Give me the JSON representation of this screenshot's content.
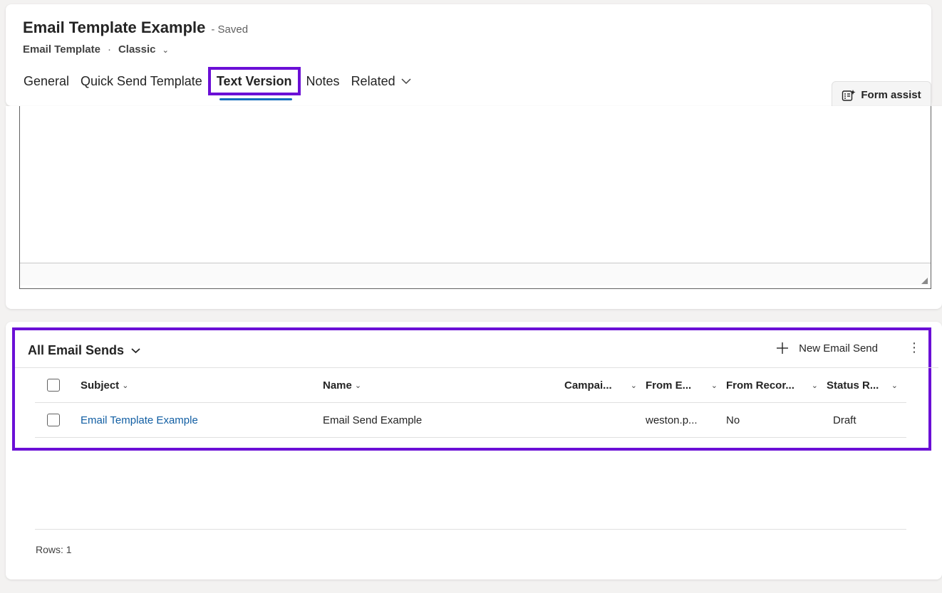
{
  "header": {
    "title": "Email Template Example",
    "status": "- Saved",
    "entity": "Email Template",
    "separator": "·",
    "form": "Classic"
  },
  "tabs": [
    {
      "label": "General"
    },
    {
      "label": "Quick Send Template"
    },
    {
      "label": "Text Version",
      "active": true
    },
    {
      "label": "Notes"
    },
    {
      "label": "Related"
    }
  ],
  "form_assist": {
    "label": "Form assist"
  },
  "grid": {
    "view_name": "All Email Sends",
    "new_button": "New Email Send",
    "columns": [
      "Subject",
      "Name",
      "Campai...",
      "From E...",
      "From Recor...",
      "Status R..."
    ],
    "rows": [
      {
        "subject": "Email Template Example",
        "name": "Email Send Example",
        "campaign": "",
        "from_email": "weston.p...",
        "from_record": "No",
        "status": "Draft"
      }
    ],
    "rows_label": "Rows: 1"
  },
  "colors": {
    "highlight": "#6b0fd6",
    "link": "#115ea3",
    "tab_underline": "#0f6cbd"
  },
  "icons": [
    "chevron-down-icon",
    "form-assist-icon",
    "plus-icon",
    "more-icon",
    "resize-grip-icon"
  ]
}
